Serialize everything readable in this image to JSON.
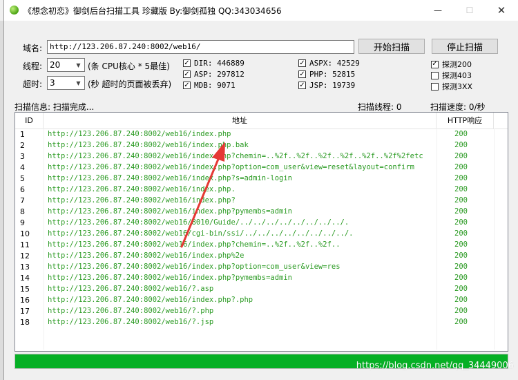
{
  "window": {
    "title": "《想念初恋》御剑后台扫描工具 珍藏版 By:御剑孤独 QQ:343034656",
    "controls": {
      "minimize": "—",
      "maximize": "☐",
      "close": "✕"
    }
  },
  "form": {
    "domain_label": "域名:",
    "domain_value": "http://123.206.87.240:8002/web16/",
    "start_button": "开始扫描",
    "stop_button": "停止扫描",
    "threads_label": "线程:",
    "threads_value": "20",
    "threads_hint": "(条 CPU核心 * 5最佳)",
    "timeout_label": "超时:",
    "timeout_value": "3",
    "timeout_hint": "(秒 超时的页面被丢弃)"
  },
  "dictionaries": [
    {
      "label": "DIR: 446889",
      "checked": true
    },
    {
      "label": "ASP: 297812",
      "checked": true
    },
    {
      "label": "MDB: 9071",
      "checked": true
    },
    {
      "label": "ASPX: 42529",
      "checked": true
    },
    {
      "label": "PHP: 52815",
      "checked": true
    },
    {
      "label": "JSP: 19739",
      "checked": true
    }
  ],
  "probes": [
    {
      "label": "探测200",
      "checked": true
    },
    {
      "label": "探测403",
      "checked": false
    },
    {
      "label": "探测3XX",
      "checked": false
    }
  ],
  "status": {
    "info": "扫描信息: 扫描完成...",
    "threads": "扫描线程: 0",
    "speed": "扫描速度: 0/秒"
  },
  "table": {
    "columns": [
      "ID",
      "地址",
      "HTTP响应"
    ],
    "rows": [
      {
        "id": "1",
        "url": "http://123.206.87.240:8002/web16/index.php",
        "code": "200"
      },
      {
        "id": "2",
        "url": "http://123.206.87.240:8002/web16/index.php.bak",
        "code": "200"
      },
      {
        "id": "3",
        "url": "http://123.206.87.240:8002/web16/index.php?chemin=..%2f..%2f..%2f..%2f..%2f..%2f%2fetc",
        "code": "200"
      },
      {
        "id": "4",
        "url": "http://123.206.87.240:8002/web16/index.php?option=com_user&view=reset&layout=confirm",
        "code": "200"
      },
      {
        "id": "5",
        "url": "http://123.206.87.240:8002/web16/index.php?s=admin-login",
        "code": "200"
      },
      {
        "id": "6",
        "url": "http://123.206.87.240:8002/web16/index.php.",
        "code": "200"
      },
      {
        "id": "7",
        "url": "http://123.206.87.240:8002/web16/index.php?",
        "code": "200"
      },
      {
        "id": "8",
        "url": "http://123.206.87.240:8002/web16/index.php?pymembs=admin",
        "code": "200"
      },
      {
        "id": "9",
        "url": "http://123.206.87.240:8002/web16/8010/Guide/../../../../../../../../.",
        "code": "200"
      },
      {
        "id": "10",
        "url": "http://123.206.87.240:8002/web16/cgi-bin/ssi/../../../../../../../../.",
        "code": "200"
      },
      {
        "id": "11",
        "url": "http://123.206.87.240:8002/web16/index.php?chemin=..%2f..%2f..%2f..",
        "code": "200"
      },
      {
        "id": "12",
        "url": "http://123.206.87.240:8002/web16/index.php%2e",
        "code": "200"
      },
      {
        "id": "13",
        "url": "http://123.206.87.240:8002/web16/index.php?option=com_user&view=res",
        "code": "200"
      },
      {
        "id": "14",
        "url": "http://123.206.87.240:8002/web16/index.php?pymembs=admin",
        "code": "200"
      },
      {
        "id": "15",
        "url": "http://123.206.87.240:8002/web16/?.asp",
        "code": "200"
      },
      {
        "id": "16",
        "url": "http://123.206.87.240:8002/web16/index.php?.php",
        "code": "200"
      },
      {
        "id": "17",
        "url": "http://123.206.87.240:8002/web16/?.php",
        "code": "200"
      },
      {
        "id": "18",
        "url": "http://123.206.87.240:8002/web16/?.jsp",
        "code": "200"
      }
    ]
  },
  "progress": {
    "percent": 100,
    "color": "#06b025"
  },
  "watermark": "https://blog.csdn.net/qq_34449006",
  "colors": {
    "url_text": "#2a9a22",
    "annotation_arrow": "#e53935"
  }
}
